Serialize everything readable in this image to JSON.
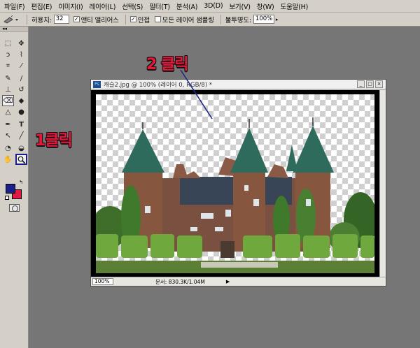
{
  "menu": [
    "파일(F)",
    "편집(E)",
    "이미지(I)",
    "레이어(L)",
    "선택(S)",
    "필터(T)",
    "분석(A)",
    "3D(D)",
    "보기(V)",
    "창(W)",
    "도움말(H)"
  ],
  "options": {
    "tolerance_label": "허용치:",
    "tolerance_value": "32",
    "antialias_label": "앤티 앨리어스",
    "contiguous_label": "인접",
    "sample_all_label": "모든 레이어 샘플링",
    "opacity_label": "불투명도:",
    "opacity_value": "100%"
  },
  "document": {
    "title": "캐슬2.jpg @ 100% (레이어 0, RGB/8) *",
    "zoom": "100%",
    "doc_info": "문서: 830.3K/1.04M"
  },
  "annotations": {
    "step1": "1클릭",
    "step2": "2 클릭"
  },
  "colors": {
    "foreground": "#1a1f8a",
    "background": "#e11a46",
    "annotation": "#e4173a"
  }
}
